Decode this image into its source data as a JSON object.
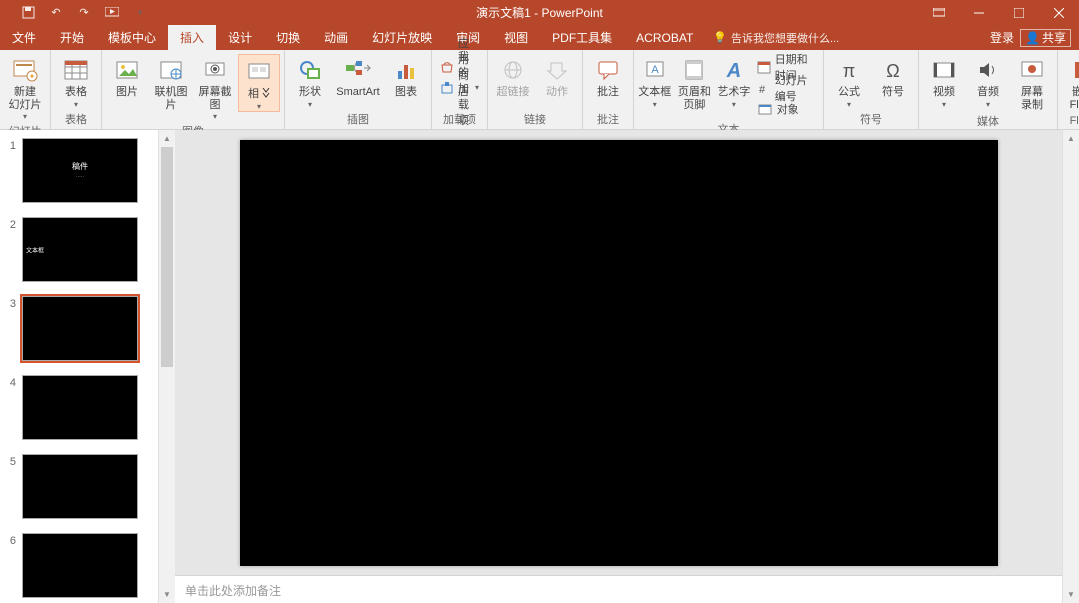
{
  "title": "演示文稿1 - PowerPoint",
  "qat": {
    "save": "save",
    "undo": "undo",
    "redo": "redo",
    "start": "start"
  },
  "tabs": [
    "文件",
    "开始",
    "模板中心",
    "插入",
    "设计",
    "切换",
    "动画",
    "幻灯片放映",
    "审阅",
    "视图",
    "PDF工具集",
    "ACROBAT"
  ],
  "active_tab": 3,
  "tellme": "告诉我您想要做什么...",
  "login": "登录",
  "share": "共享",
  "ribbon": {
    "groups": [
      {
        "label": "幻灯片",
        "items": [
          {
            "k": "new_slide",
            "l": "新建\n幻灯片",
            "drop": true
          }
        ]
      },
      {
        "label": "表格",
        "items": [
          {
            "k": "table",
            "l": "表格",
            "drop": true
          }
        ]
      },
      {
        "label": "图像",
        "items": [
          {
            "k": "picture",
            "l": "图片"
          },
          {
            "k": "online_pic",
            "l": "联机图片"
          },
          {
            "k": "screenshot",
            "l": "屏幕截图",
            "drop": true
          },
          {
            "k": "album",
            "l": "相册",
            "drop": true,
            "hover": true
          }
        ]
      },
      {
        "label": "插图",
        "items": [
          {
            "k": "shapes",
            "l": "形状",
            "drop": true
          },
          {
            "k": "smartart",
            "l": "SmartArt"
          },
          {
            "k": "chart",
            "l": "图表"
          }
        ]
      },
      {
        "label": "加载项",
        "small": true,
        "items": [
          {
            "k": "store",
            "l": "应用商店"
          },
          {
            "k": "myaddins",
            "l": "我的加载项",
            "drop": true
          }
        ]
      },
      {
        "label": "链接",
        "items": [
          {
            "k": "hyperlink",
            "l": "超链接",
            "dim": true
          },
          {
            "k": "action",
            "l": "动作",
            "dim": true
          }
        ]
      },
      {
        "label": "批注",
        "items": [
          {
            "k": "comment",
            "l": "批注"
          }
        ]
      },
      {
        "label": "文本",
        "mixed": true,
        "items_big": [
          {
            "k": "textbox",
            "l": "文本框",
            "drop": true
          },
          {
            "k": "header_footer",
            "l": "页眉和页脚"
          },
          {
            "k": "wordart",
            "l": "艺术字",
            "drop": true
          }
        ],
        "items_small": [
          {
            "k": "datetime",
            "l": "日期和时间"
          },
          {
            "k": "slidenum",
            "l": "幻灯片编号"
          },
          {
            "k": "object",
            "l": "对象"
          }
        ]
      },
      {
        "label": "符号",
        "items": [
          {
            "k": "equation",
            "l": "公式",
            "drop": true
          },
          {
            "k": "symbol",
            "l": "符号"
          }
        ]
      },
      {
        "label": "媒体",
        "items": [
          {
            "k": "video",
            "l": "视频",
            "drop": true
          },
          {
            "k": "audio",
            "l": "音频",
            "drop": true
          },
          {
            "k": "screenrec",
            "l": "屏幕\n录制"
          }
        ]
      },
      {
        "label": "Flash",
        "items": [
          {
            "k": "flash",
            "l": "嵌入\nFlash"
          }
        ]
      }
    ]
  },
  "thumbs": [
    {
      "n": 1,
      "title": "稿件",
      "sub": "·····"
    },
    {
      "n": 2,
      "ltext": "文本框"
    },
    {
      "n": 3,
      "sel": true
    },
    {
      "n": 4
    },
    {
      "n": 5
    },
    {
      "n": 6
    }
  ],
  "notes_placeholder": "单击此处添加备注"
}
